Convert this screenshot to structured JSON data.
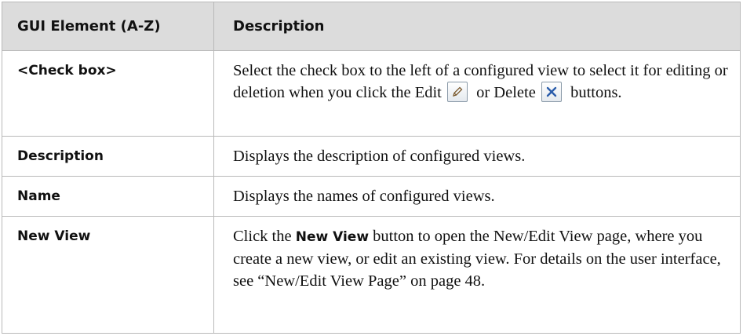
{
  "header": {
    "col1": "GUI Element (A-Z)",
    "col2": "Description"
  },
  "rows": [
    {
      "name": "<Check box>",
      "desc_a": "Select the check box to the left of a configured view to select it for editing or deletion when you click the Edit",
      "desc_b": "or Delete",
      "desc_c": "buttons.",
      "icons": [
        "pencil-icon",
        "x-icon"
      ]
    },
    {
      "name": "Description",
      "desc": "Displays the description of configured views."
    },
    {
      "name": "Name",
      "desc": "Displays the names of configured views."
    },
    {
      "name": "New View",
      "desc_pre": "Click the",
      "desc_bold": "New View",
      "desc_post": "button to open the New/Edit View page, where you create a new view, or edit an existing view. For details on the user interface, see “New/Edit View Page” on page 48."
    }
  ],
  "colors": {
    "header_bg": "#dcdcdc",
    "border": "#b9b9b9",
    "x_icon": "#2a5caa",
    "pencil_icon": "#7a5a2e"
  }
}
